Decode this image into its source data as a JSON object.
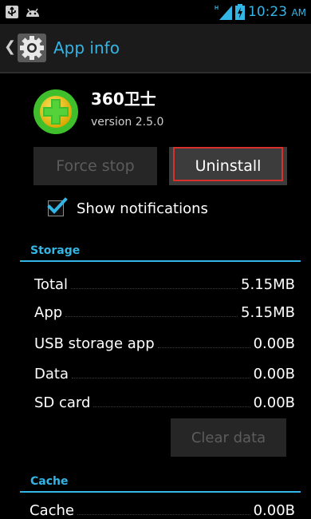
{
  "status_bar": {
    "time": "10:23",
    "ampm": "AM",
    "icons": [
      "usb-icon",
      "android-icon",
      "signal-icon",
      "battery-icon"
    ]
  },
  "action_bar": {
    "title": "App info",
    "icon": "settings-gear-icon"
  },
  "app": {
    "name": "360卫士",
    "version": "version 2.5.0",
    "icon": "app-icon"
  },
  "buttons": {
    "force_stop": "Force stop",
    "uninstall": "Uninstall",
    "clear_data": "Clear data"
  },
  "notifications": {
    "label": "Show notifications",
    "checked": true
  },
  "storage": {
    "header": "Storage",
    "rows": [
      {
        "label": "Total",
        "value": "5.15MB"
      },
      {
        "label": "App",
        "value": "5.15MB"
      },
      {
        "label": "USB storage app",
        "value": "0.00B"
      },
      {
        "label": "Data",
        "value": "0.00B"
      },
      {
        "label": "SD card",
        "value": "0.00B"
      }
    ]
  },
  "cache": {
    "header": "Cache",
    "rows": [
      {
        "label": "Cache",
        "value": "0.00B"
      }
    ]
  },
  "colors": {
    "accent": "#33b5e5",
    "highlight": "#d9302c",
    "background": "#000000"
  }
}
